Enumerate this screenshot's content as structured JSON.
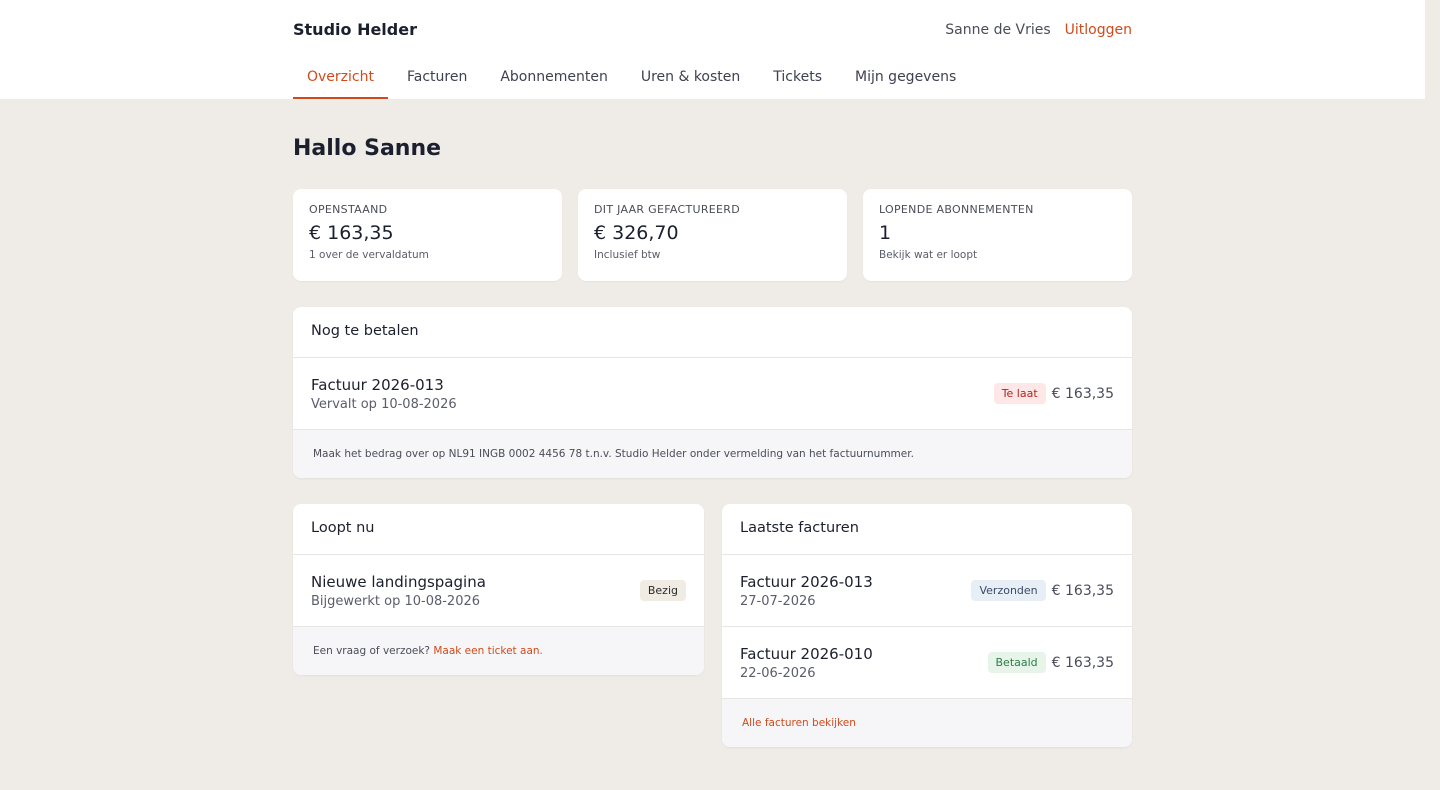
{
  "header": {
    "brand": "Studio Helder",
    "user_name": "Sanne de Vries",
    "logout_label": "Uitloggen"
  },
  "nav": {
    "tabs": [
      {
        "label": "Overzicht",
        "active": true
      },
      {
        "label": "Facturen"
      },
      {
        "label": "Abonnementen"
      },
      {
        "label": "Uren & kosten"
      },
      {
        "label": "Tickets"
      },
      {
        "label": "Mijn gegevens"
      }
    ]
  },
  "page": {
    "title": "Hallo Sanne"
  },
  "stats": [
    {
      "label": "OPENSTAAND",
      "value": "€ 163,35",
      "sub": "1 over de vervaldatum"
    },
    {
      "label": "DIT JAAR GEFACTUREERD",
      "value": "€ 326,70",
      "sub": "Inclusief btw"
    },
    {
      "label": "LOPENDE ABONNEMENTEN",
      "value": "1",
      "sub": "Bekijk wat er loopt"
    }
  ],
  "due": {
    "title": "Nog te betalen",
    "invoice": {
      "name": "Factuur 2026-013",
      "meta": "Vervalt op 10-08-2026",
      "badge": "Te laat",
      "amount": "€ 163,35"
    },
    "note": "Maak het bedrag over op NL91 INGB 0002 4456 78 t.n.v. Studio Helder onder vermelding van het factuurnummer."
  },
  "running": {
    "title": "Loopt nu",
    "item": {
      "name": "Nieuwe landingspagina",
      "meta": "Bijgewerkt op 10-08-2026",
      "badge": "Bezig"
    },
    "foot_text": "Een vraag of verzoek? ",
    "foot_link": "Maak een ticket aan."
  },
  "latest": {
    "title": "Laatste facturen",
    "items": [
      {
        "name": "Factuur 2026-013",
        "date": "27-07-2026",
        "badge": "Verzonden",
        "amount": "€ 163,35"
      },
      {
        "name": "Factuur 2026-010",
        "date": "22-06-2026",
        "badge": "Betaald",
        "amount": "€ 163,35"
      }
    ],
    "foot_link": "Alle facturen bekijken"
  },
  "colors": {
    "accent": "#d14a1b",
    "background": "#efece7"
  }
}
